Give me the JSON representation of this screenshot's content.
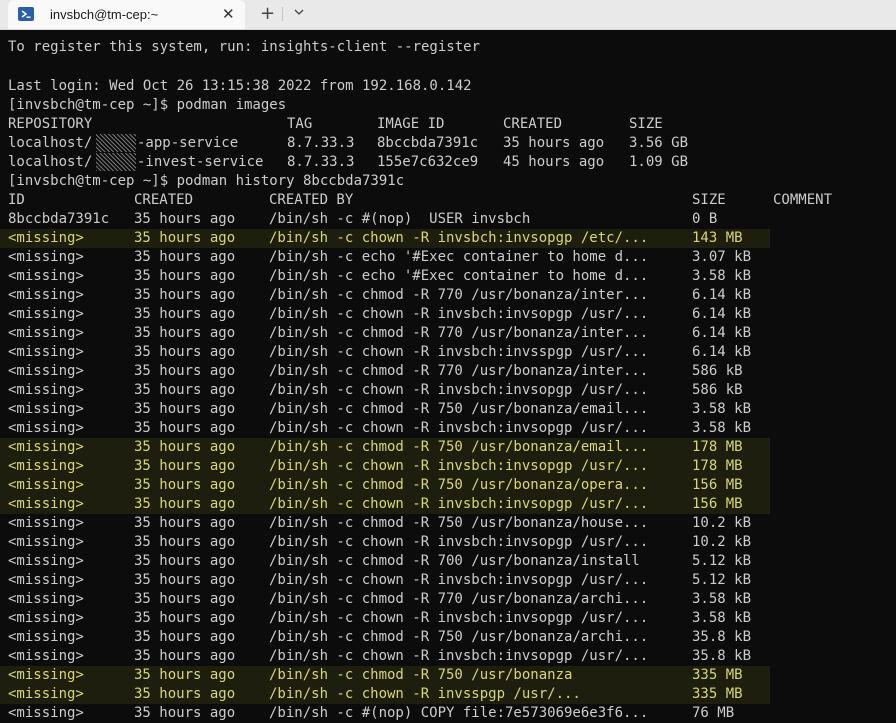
{
  "window": {
    "tab_title": "invsbch@tm-cep:~",
    "new_tab_label": "+",
    "close_label": "✕"
  },
  "terminal": {
    "register_msg": "To register this system, run: insights-client --register",
    "last_login": "Last login: Wed Oct 26 13:15:38 2022 from 192.168.0.142",
    "prompt1": "[invsbch@tm-cep ~]$ podman images",
    "images_header": [
      "REPOSITORY",
      "TAG",
      "IMAGE ID",
      "CREATED",
      "SIZE"
    ],
    "images": [
      {
        "repo_prefix": "localhost/",
        "repo_suffix": "-app-service",
        "tag": "8.7.33.3",
        "id": "8bccbda7391c",
        "created": "35 hours ago",
        "size": "3.56 GB"
      },
      {
        "repo_prefix": "localhost/",
        "repo_suffix": "-invest-service",
        "tag": "8.7.33.3",
        "id": "155e7c632ce9",
        "created": "45 hours ago",
        "size": "1.09 GB"
      }
    ],
    "prompt2": "[invsbch@tm-cep ~]$ podman history 8bccbda7391c",
    "history_header": [
      "ID",
      "CREATED",
      "CREATED BY",
      "SIZE",
      "COMMENT"
    ],
    "history": [
      {
        "id": "8bccbda7391c",
        "created": "35 hours ago",
        "by": "/bin/sh -c #(nop)  USER invsbch",
        "size": "0 B",
        "hl": false
      },
      {
        "id": "<missing>",
        "created": "35 hours ago",
        "by": "/bin/sh -c chown -R invsbch:invsopgp /etc/...",
        "size": "143 MB",
        "hl": true
      },
      {
        "id": "<missing>",
        "created": "35 hours ago",
        "by": "/bin/sh -c echo '#Exec container to home d...",
        "size": "3.07 kB",
        "hl": false
      },
      {
        "id": "<missing>",
        "created": "35 hours ago",
        "by": "/bin/sh -c echo '#Exec container to home d...",
        "size": "3.58 kB",
        "hl": false
      },
      {
        "id": "<missing>",
        "created": "35 hours ago",
        "by": "/bin/sh -c chmod -R 770 /usr/bonanza/inter...",
        "size": "6.14 kB",
        "hl": false
      },
      {
        "id": "<missing>",
        "created": "35 hours ago",
        "by": "/bin/sh -c chown -R invsbch:invsopgp /usr/...",
        "size": "6.14 kB",
        "hl": false
      },
      {
        "id": "<missing>",
        "created": "35 hours ago",
        "by": "/bin/sh -c chmod -R 770 /usr/bonanza/inter...",
        "size": "6.14 kB",
        "hl": false
      },
      {
        "id": "<missing>",
        "created": "35 hours ago",
        "by": "/bin/sh -c chown -R invsbch:invsspgp /usr/...",
        "size": "6.14 kB",
        "hl": false
      },
      {
        "id": "<missing>",
        "created": "35 hours ago",
        "by": "/bin/sh -c chmod -R 770 /usr/bonanza/inter...",
        "size": "586 kB",
        "hl": false
      },
      {
        "id": "<missing>",
        "created": "35 hours ago",
        "by": "/bin/sh -c chown -R invsbch:invsopgp /usr/...",
        "size": "586 kB",
        "hl": false
      },
      {
        "id": "<missing>",
        "created": "35 hours ago",
        "by": "/bin/sh -c chmod -R 750 /usr/bonanza/email...",
        "size": "3.58 kB",
        "hl": false
      },
      {
        "id": "<missing>",
        "created": "35 hours ago",
        "by": "/bin/sh -c chown -R invsbch:invsopgp /usr/...",
        "size": "3.58 kB",
        "hl": false
      },
      {
        "id": "<missing>",
        "created": "35 hours ago",
        "by": "/bin/sh -c chmod -R 750 /usr/bonanza/email...",
        "size": "178 MB",
        "hl": true
      },
      {
        "id": "<missing>",
        "created": "35 hours ago",
        "by": "/bin/sh -c chown -R invsbch:invsopgp /usr/...",
        "size": "178 MB",
        "hl": true
      },
      {
        "id": "<missing>",
        "created": "35 hours ago",
        "by": "/bin/sh -c chmod -R 750 /usr/bonanza/opera...",
        "size": "156 MB",
        "hl": true
      },
      {
        "id": "<missing>",
        "created": "35 hours ago",
        "by": "/bin/sh -c chown -R invsbch:invsopgp /usr/...",
        "size": "156 MB",
        "hl": true
      },
      {
        "id": "<missing>",
        "created": "35 hours ago",
        "by": "/bin/sh -c chmod -R 750 /usr/bonanza/house...",
        "size": "10.2 kB",
        "hl": false
      },
      {
        "id": "<missing>",
        "created": "35 hours ago",
        "by": "/bin/sh -c chown -R invsbch:invsopgp /usr/...",
        "size": "10.2 kB",
        "hl": false
      },
      {
        "id": "<missing>",
        "created": "35 hours ago",
        "by": "/bin/sh -c chmod -R 700 /usr/bonanza/install",
        "size": "5.12 kB",
        "hl": false
      },
      {
        "id": "<missing>",
        "created": "35 hours ago",
        "by": "/bin/sh -c chown -R invsbch:invsopgp /usr/...",
        "size": "5.12 kB",
        "hl": false
      },
      {
        "id": "<missing>",
        "created": "35 hours ago",
        "by": "/bin/sh -c chmod -R 770 /usr/bonanza/archi...",
        "size": "3.58 kB",
        "hl": false
      },
      {
        "id": "<missing>",
        "created": "35 hours ago",
        "by": "/bin/sh -c chown -R invsbch:invsopgp /usr/...",
        "size": "3.58 kB",
        "hl": false
      },
      {
        "id": "<missing>",
        "created": "35 hours ago",
        "by": "/bin/sh -c chmod -R 750 /usr/bonanza/archi...",
        "size": "35.8 kB",
        "hl": false
      },
      {
        "id": "<missing>",
        "created": "35 hours ago",
        "by": "/bin/sh -c chown -R invsbch:invsopgp /usr/...",
        "size": "35.8 kB",
        "hl": false
      },
      {
        "id": "<missing>",
        "created": "35 hours ago",
        "by": "/bin/sh -c chmod -R 750 /usr/bonanza",
        "size": "335 MB",
        "hl": true
      },
      {
        "id": "<missing>",
        "created": "35 hours ago",
        "by": "/bin/sh -c chown -R invsspgp /usr/...",
        "size": "335 MB",
        "hl": true
      },
      {
        "id": "<missing>",
        "created": "35 hours ago",
        "by": "/bin/sh -c #(nop) COPY file:7e573069e6e3f6...",
        "size": "76 MB",
        "hl": false
      }
    ]
  },
  "colors": {
    "background": "#0c0c0c",
    "text": "#cccccc",
    "highlight": "#d8d870"
  }
}
